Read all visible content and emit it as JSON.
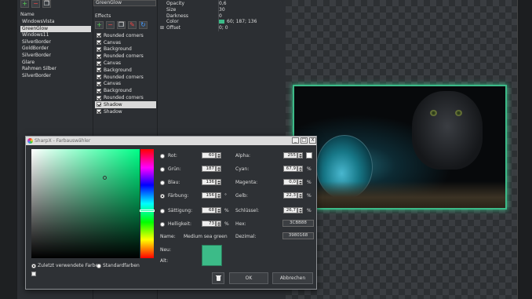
{
  "presets": {
    "header": "Name",
    "items": [
      "WindowsVista",
      "GreenGlow",
      "Windows11",
      "SilverBorder",
      "GoldBorder",
      "SilverBorder",
      "Glare",
      "Rahmen Silber",
      "SilverBorder"
    ],
    "selected_index": 1
  },
  "effects": {
    "name_value": "GreenGlow",
    "label": "Effects",
    "items": [
      "Rounded corners",
      "Canvas",
      "Background",
      "Rounded corners",
      "Canvas",
      "Background",
      "Rounded corners",
      "Canvas",
      "Background",
      "Rounded corners",
      "Shadow",
      "Shadow"
    ],
    "selected_index": 10
  },
  "properties": {
    "rows": [
      {
        "key": "Opacity",
        "value": "0,6"
      },
      {
        "key": "Size",
        "value": "30"
      },
      {
        "key": "Darkness",
        "value": "0"
      },
      {
        "key": "Color",
        "value": "60; 187; 136"
      },
      {
        "key": "Offset",
        "value": "0; 0"
      }
    ],
    "offset_expander": "⊞"
  },
  "colors": {
    "accent": "#3cbb88"
  },
  "dialog": {
    "title": "SharpX - Farbauswähler",
    "min": "_",
    "max": "□",
    "close": "X",
    "fields_left": [
      {
        "label": "Rot:",
        "value": "60",
        "unit": ""
      },
      {
        "label": "Grün:",
        "value": "187",
        "unit": ""
      },
      {
        "label": "Blau:",
        "value": "136",
        "unit": ""
      },
      {
        "label": "Färbung:",
        "value": "156",
        "unit": "°"
      },
      {
        "label": "Sättigung:",
        "value": "68",
        "unit": "%"
      },
      {
        "label": "Helligkeit:",
        "value": "73",
        "unit": "%"
      }
    ],
    "fields_right": [
      {
        "label": "Alpha:",
        "value": "255",
        "unit": ""
      },
      {
        "label": "Cyan:",
        "value": "67,9",
        "unit": "%"
      },
      {
        "label": "Magenta:",
        "value": "0,0",
        "unit": "%"
      },
      {
        "label": "Gelb:",
        "value": "22,3",
        "unit": "%"
      },
      {
        "label": "Schlüssel:",
        "value": "26,7",
        "unit": "%"
      }
    ],
    "name_label": "Name:",
    "name_value": "Medium sea green",
    "hex_label": "Hex:",
    "hex_value": "3CBB88",
    "dec_label": "Dezimal:",
    "dec_value": "3980168",
    "new_label": "Neu:",
    "old_label": "Alt:",
    "recent_label": "Zuletzt verwendete Farben",
    "standard_label": "Standardfarben",
    "ok_label": "OK",
    "cancel_label": "Abbrechen"
  }
}
